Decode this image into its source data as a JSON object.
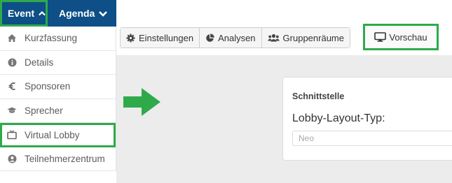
{
  "nav": {
    "event_label": "Event",
    "agenda_label": "Agenda"
  },
  "menu": {
    "items": [
      {
        "label": "Kurzfassung",
        "icon": "home-icon"
      },
      {
        "label": "Details",
        "icon": "info-icon"
      },
      {
        "label": "Sponsoren",
        "icon": "euro-icon"
      },
      {
        "label": "Sprecher",
        "icon": "graduation-cap-icon"
      },
      {
        "label": "Virtual Lobby",
        "icon": "tv-icon",
        "active": true
      },
      {
        "label": "Teilnehmerzentrum",
        "icon": "user-circle-icon"
      }
    ]
  },
  "toolbar": {
    "settings_label": "Einstellungen",
    "analytics_label": "Analysen",
    "groups_label": "Gruppenräume",
    "preview_label": "Vorschau"
  },
  "panel": {
    "title": "Schnittstelle",
    "field_label": "Lobby-Layout-Typ:",
    "select_value": "Neo"
  },
  "colors": {
    "nav_bg": "#0d4f86",
    "highlight": "#2eaa4b",
    "content_bg": "#ececec"
  }
}
